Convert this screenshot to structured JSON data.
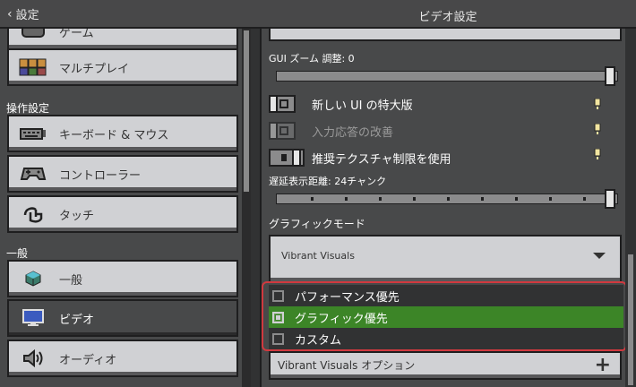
{
  "header": {
    "back_label": "設定",
    "title": "ビデオ設定"
  },
  "sidebar": {
    "items_top": [
      {
        "label": "ゲーム",
        "icon": "game-icon"
      },
      {
        "label": "マルチプレイ",
        "icon": "multiplayer-icon"
      }
    ],
    "section_controls": "操作設定",
    "controls_items": [
      {
        "label": "キーボード & マウス",
        "icon": "keyboard-icon"
      },
      {
        "label": "コントローラー",
        "icon": "controller-icon"
      },
      {
        "label": "タッチ",
        "icon": "touch-icon"
      }
    ],
    "section_general": "一般",
    "general_items": [
      {
        "label": "一般",
        "icon": "globe-icon"
      },
      {
        "label": "ビデオ",
        "icon": "monitor-icon",
        "selected": true
      },
      {
        "label": "オーディオ",
        "icon": "speaker-icon"
      }
    ]
  },
  "video": {
    "gui_zoom_label": "GUI ズーム 調整: 0",
    "gui_zoom_fraction": 1.0,
    "toggles": [
      {
        "label": "新しい UI の特大版",
        "on": false,
        "disabled": false
      },
      {
        "label": "入力応答の改善",
        "on": false,
        "disabled": true
      },
      {
        "label": "推奨テクスチャ制限を使用",
        "on": true,
        "disabled": false
      }
    ],
    "render_distance_label": "遅延表示距離: 24チャンク",
    "render_distance_fraction": 1.0,
    "graphics_mode_label": "グラフィックモード",
    "graphics_mode_value": "Vibrant Visuals",
    "graphics_options": [
      {
        "label": "パフォーマンス優先",
        "selected": false
      },
      {
        "label": "グラフィック優先",
        "selected": true
      },
      {
        "label": "カスタム",
        "selected": false
      }
    ],
    "vibrant_options_label": "Vibrant Visuals オプション"
  },
  "colors": {
    "panel": "#48494a",
    "button": "#d0d1d4",
    "selected_green": "#3c8527",
    "highlight_red": "#d0393f"
  }
}
